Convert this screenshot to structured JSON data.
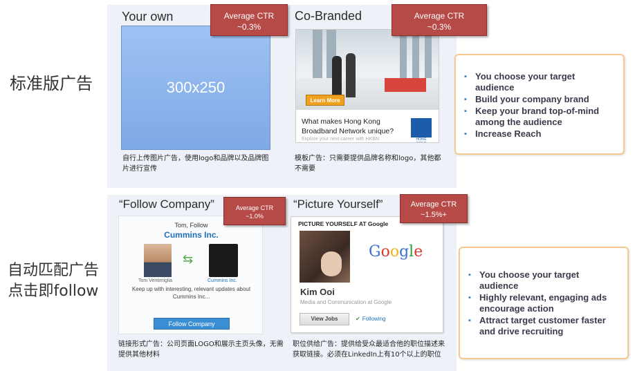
{
  "row_labels": {
    "standard": "标准版广告",
    "auto_match_line1": "自动匹配广告",
    "auto_match_line2": "点击即follow"
  },
  "ads": [
    {
      "title": "Your own",
      "ctr_label": "Average CTR",
      "ctr_value": "~0.3%",
      "placeholder": "300x250",
      "description": "自行上传图片广告，使用logo和品牌以及品牌图片进行宣传"
    },
    {
      "title": "Co-Branded",
      "ctr_label": "Average CTR",
      "ctr_value": "~0.3%",
      "creative": {
        "button": "Learn More",
        "caption": "What makes Hong Kong Broadband Network unique?",
        "subcaption": "Explore your next career with HKBN",
        "logo_text": "HONG KONG BROADBAND NETWORK"
      },
      "description": "模板广告：只需要提供品牌名称和logo，其他都不需要"
    },
    {
      "title": "“Follow Company”",
      "ctr_label": "Average CTR",
      "ctr_value": "~1.0%",
      "creative": {
        "who": "Tom, Follow",
        "company": "Cummins Inc.",
        "photo_name": "Tom Ventimiglia",
        "logo_name": "Cummins Inc.",
        "message": "Keep up with interesting, relevant updates about Cummins Inc...",
        "button": "Follow Company"
      },
      "description": "链接形式广告：公司页面LOGO和展示主页头像，无需提供其他材料"
    },
    {
      "title": "“Picture Yourself”",
      "ctr_label": "Average CTR",
      "ctr_value": "~1.5%+",
      "creative": {
        "header": "PICTURE YOURSELF AT Google",
        "brand": "Google",
        "name": "Kim Ooi",
        "role": "Media and Communication  at Google",
        "button": "View Jobs",
        "following": "Following"
      },
      "description": "职位供给广告：提供给受众最适合他的职位描述来获取链接。必须在LinkedIn上有10个以上的职位"
    }
  ],
  "callouts": {
    "standard": [
      "You choose your target audience",
      "Build your  company brand",
      "Keep your brand top-of-mind among the audience",
      "Increase Reach"
    ],
    "auto_match": [
      "You choose your target audience",
      "Highly relevant, engaging ads encourage action",
      "Attract target customer faster and drive recruiting"
    ]
  },
  "colors": {
    "ctr_badge": "#b64a47",
    "panel_bg": "#eef2f8",
    "callout_border": "#f5c98e",
    "link_blue": "#1d6fb8"
  }
}
